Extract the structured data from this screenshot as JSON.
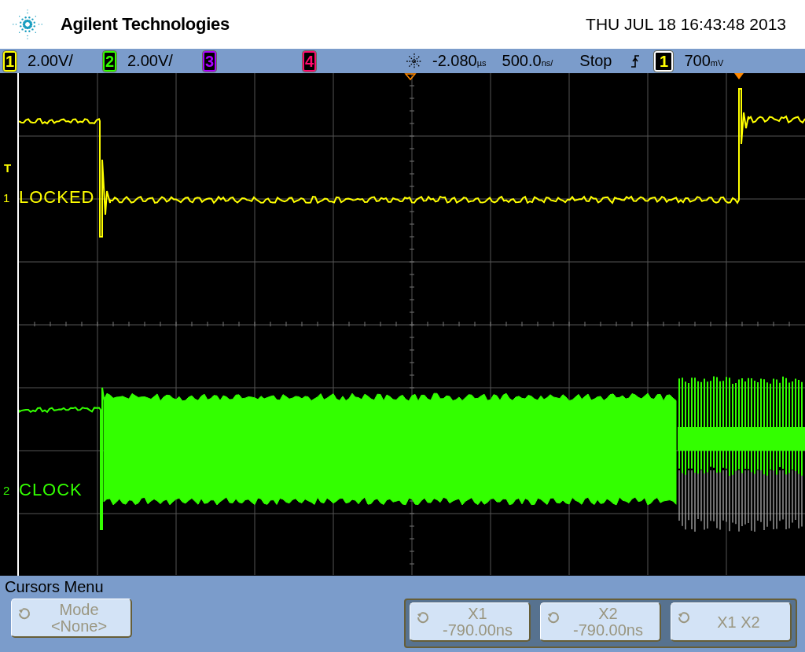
{
  "header": {
    "brand": "Agilent Technologies",
    "datetime": "THU JUL 18 16:43:48 2013"
  },
  "channels": [
    {
      "number": "1",
      "scale": "2.00V/",
      "color": "#ffff00"
    },
    {
      "number": "2",
      "scale": "2.00V/",
      "color": "#33ff00"
    },
    {
      "number": "3",
      "color": "#aa00ff"
    },
    {
      "number": "4",
      "color": "#ff0a6e"
    }
  ],
  "horizontal": {
    "delay": "-2.080",
    "delay_unit": "µs",
    "scale": "500.0",
    "scale_unit": "ns/"
  },
  "run_state": "Stop",
  "trigger": {
    "source": "1",
    "level": "700",
    "level_unit": "mV"
  },
  "markers": {
    "trigger": "T"
  },
  "traces": [
    {
      "marker": "1",
      "label": "LOCKED"
    },
    {
      "marker": "2",
      "label": "CLOCK"
    }
  ],
  "menu": {
    "title": "Cursors Menu",
    "softkeys": [
      {
        "label": "Mode",
        "value": "<None>"
      }
    ],
    "cursor_keys": [
      {
        "label": "X1",
        "value": "-790.00ns"
      },
      {
        "label": "X2",
        "value": "-790.00ns"
      },
      {
        "label": "X1 X2"
      }
    ]
  }
}
